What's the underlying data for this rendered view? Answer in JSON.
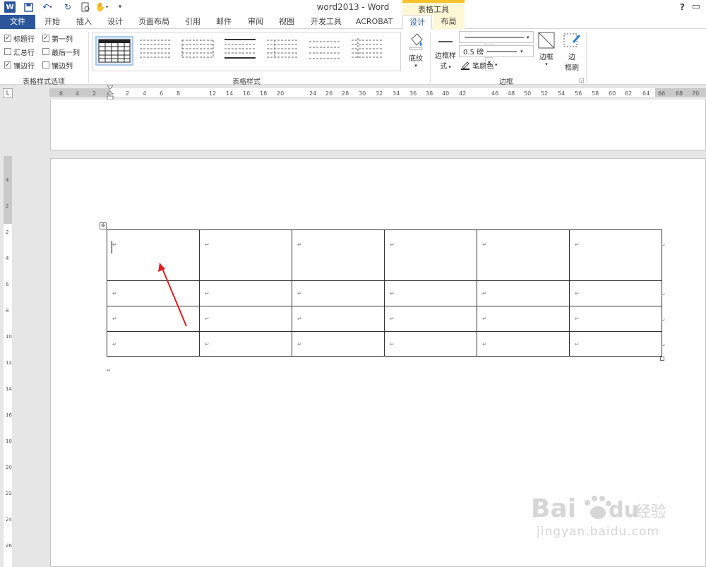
{
  "titlebar": {
    "title": "word2013 - Word",
    "context_group": "表格工具",
    "help": "?",
    "icon_text": "W"
  },
  "tabs": {
    "file": "文件",
    "home": "开始",
    "insert": "插入",
    "design1": "设计",
    "layout_page": "页面布局",
    "references": "引用",
    "mailings": "邮件",
    "review": "审阅",
    "view": "视图",
    "developer": "开发工具",
    "acrobat": "ACROBAT",
    "design": "设计",
    "layout": "布局"
  },
  "ribbon": {
    "options": {
      "header_row": "标题行",
      "first_col": "第一列",
      "total_row": "汇总行",
      "last_col": "最后一列",
      "banded_rows": "镶边行",
      "banded_cols": "镶边列",
      "group_label": "表格样式选项",
      "checked": {
        "header_row": true,
        "first_col": true,
        "total_row": false,
        "last_col": false,
        "banded_rows": true,
        "banded_cols": false
      }
    },
    "styles": {
      "group_label": "表格样式"
    },
    "shading": "底纹",
    "borders": {
      "border_styles_l1": "边框样",
      "border_styles_l2": "式",
      "line_weight": "0.5 磅",
      "pen_color": "笔颜色",
      "borders_btn": "边框",
      "painter_l1": "边",
      "painter_l2": "框刷",
      "group_label": "边框"
    }
  },
  "ruler": {
    "h_ticks": [
      "6",
      "4",
      "2",
      "2",
      "4",
      "6",
      "8",
      "12",
      "14",
      "16",
      "18",
      "20",
      "24",
      "26",
      "28",
      "30",
      "32",
      "34",
      "36",
      "38",
      "40",
      "42",
      "46",
      "48",
      "50",
      "52",
      "54",
      "56",
      "58",
      "60",
      "62",
      "64",
      "66",
      "68",
      "70"
    ],
    "v_ticks": [
      "4",
      "2",
      "2",
      "4",
      "6",
      "8",
      "10",
      "12",
      "14",
      "16",
      "18",
      "20",
      "22",
      "24",
      "26"
    ]
  },
  "document": {
    "table": {
      "rows": 4,
      "cols": 6,
      "cell_mark": "↵"
    },
    "para_mark": "↵"
  },
  "watermark": {
    "brand": "Bai du 经验",
    "url": "jingyan.baidu.com"
  },
  "colors": {
    "accent": "#2b579a",
    "context": "#f5c32c",
    "arrow": "#e02020"
  }
}
